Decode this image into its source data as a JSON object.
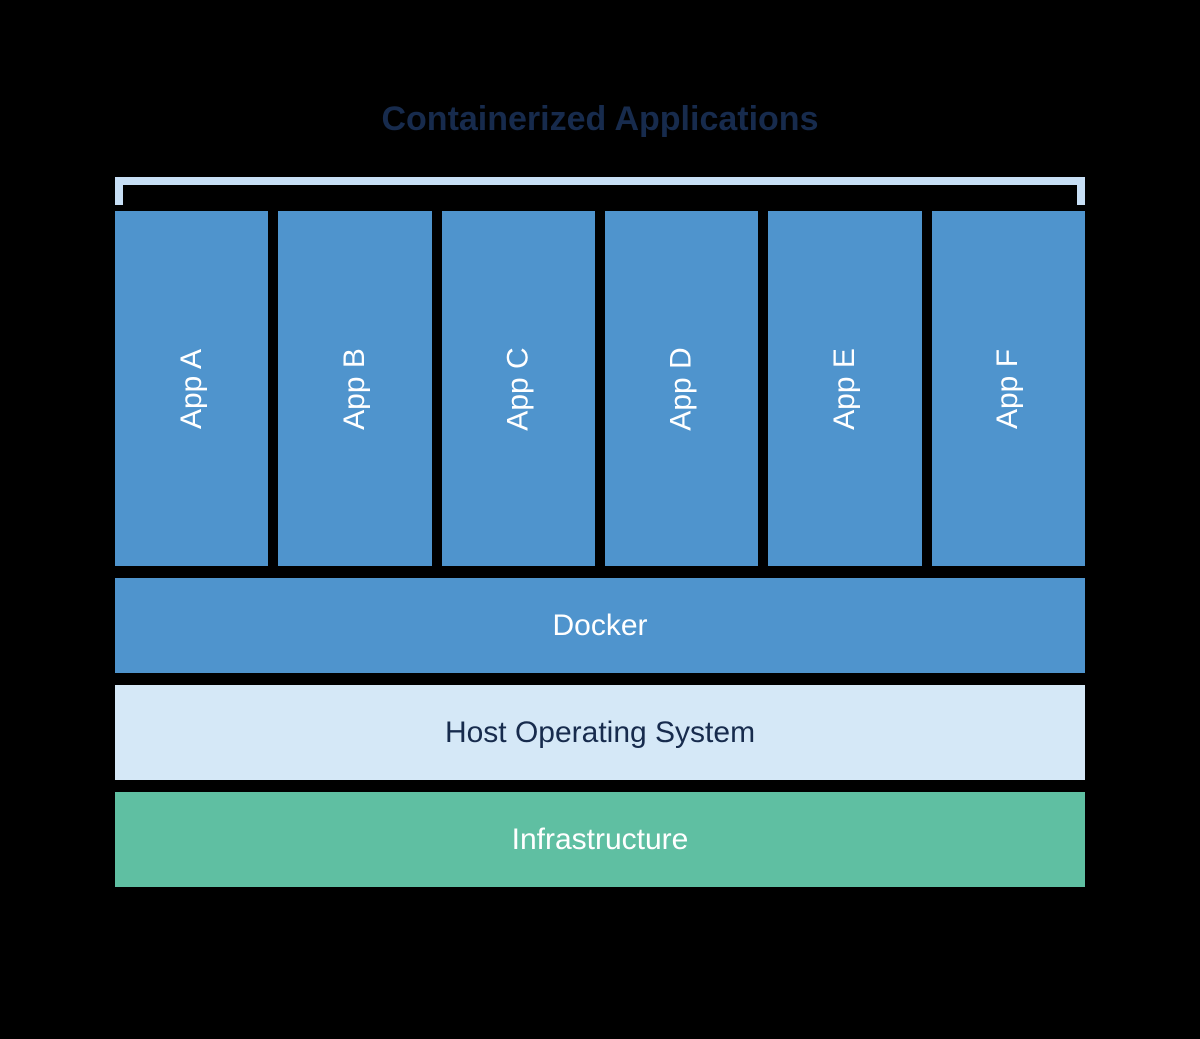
{
  "title": "Containerized Applications",
  "apps": {
    "0": {
      "label": "App A"
    },
    "1": {
      "label": "App B"
    },
    "2": {
      "label": "App C"
    },
    "3": {
      "label": "App D"
    },
    "4": {
      "label": "App E"
    },
    "5": {
      "label": "App F"
    }
  },
  "layers": {
    "docker": "Docker",
    "host": "Host Operating System",
    "infra": "Infrastructure"
  },
  "colors": {
    "app_blue": "#4f94cd",
    "light_blue": "#d5e8f7",
    "green": "#5fbfa2",
    "dark_text": "#172b4d",
    "bracket": "#c7dff5"
  }
}
